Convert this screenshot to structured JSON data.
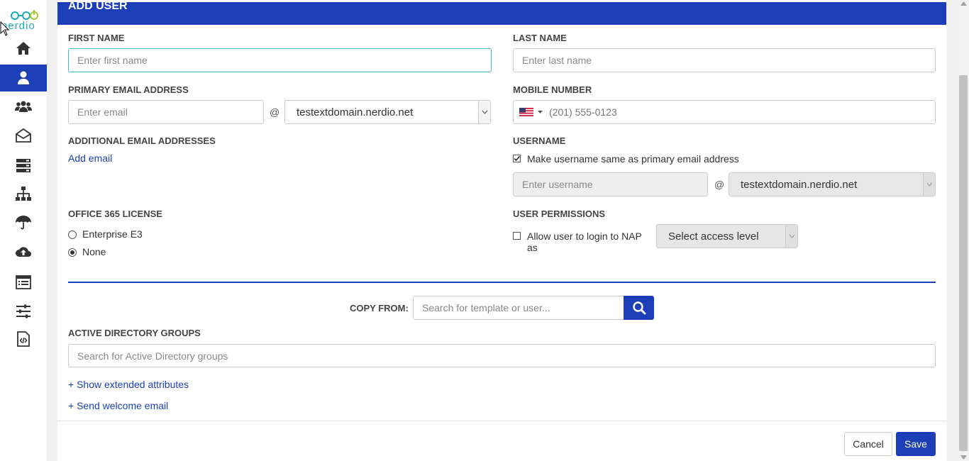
{
  "logo": {
    "text": "nerdio"
  },
  "sidebar": {
    "items": [
      {
        "name": "home-icon",
        "active": false
      },
      {
        "name": "user-icon",
        "active": true
      },
      {
        "name": "users-group-icon",
        "active": false
      },
      {
        "name": "envelope-open-icon",
        "active": false
      },
      {
        "name": "server-icon",
        "active": false
      },
      {
        "name": "sitemap-icon",
        "active": false
      },
      {
        "name": "umbrella-icon",
        "active": false
      },
      {
        "name": "cloud-upload-icon",
        "active": false
      },
      {
        "name": "list-icon",
        "active": false
      },
      {
        "name": "sliders-icon",
        "active": false
      },
      {
        "name": "code-file-icon",
        "active": false
      }
    ]
  },
  "header": {
    "title": "ADD USER"
  },
  "form": {
    "first_name": {
      "label": "FIRST NAME",
      "placeholder": "Enter first name"
    },
    "last_name": {
      "label": "LAST NAME",
      "placeholder": "Enter last name"
    },
    "primary_email": {
      "label": "PRIMARY EMAIL ADDRESS",
      "placeholder": "Enter email",
      "at": "@",
      "domain": "testextdomain.nerdio.net"
    },
    "mobile": {
      "label": "MOBILE NUMBER",
      "placeholder": "(201) 555-0123"
    },
    "additional_email": {
      "label": "ADDITIONAL EMAIL ADDRESSES",
      "add_link": "Add email"
    },
    "username": {
      "label": "USERNAME",
      "same_as_email_label": "Make username same as primary email address",
      "same_as_email_checked": true,
      "placeholder": "Enter username",
      "at": "@",
      "domain": "testextdomain.nerdio.net"
    },
    "license": {
      "label": "OFFICE 365 LICENSE",
      "options": [
        {
          "label": "Enterprise E3",
          "checked": false
        },
        {
          "label": "None",
          "checked": true
        }
      ]
    },
    "permissions": {
      "label": "USER PERMISSIONS",
      "allow_label": "Allow user to login to NAP as",
      "allow_checked": false,
      "access_level": "Select access level"
    },
    "copy_from": {
      "label": "COPY FROM:",
      "placeholder": "Search for template or user..."
    },
    "ad_groups": {
      "label": "ACTIVE DIRECTORY GROUPS",
      "placeholder": "Search for Active Directory groups"
    },
    "extended_link": "+ Show extended attributes",
    "welcome_link": "+ Send welcome email"
  },
  "footer": {
    "cancel": "Cancel",
    "save": "Save"
  },
  "colors": {
    "primary": "#1c3fb7",
    "accent": "#1fa8b8"
  }
}
